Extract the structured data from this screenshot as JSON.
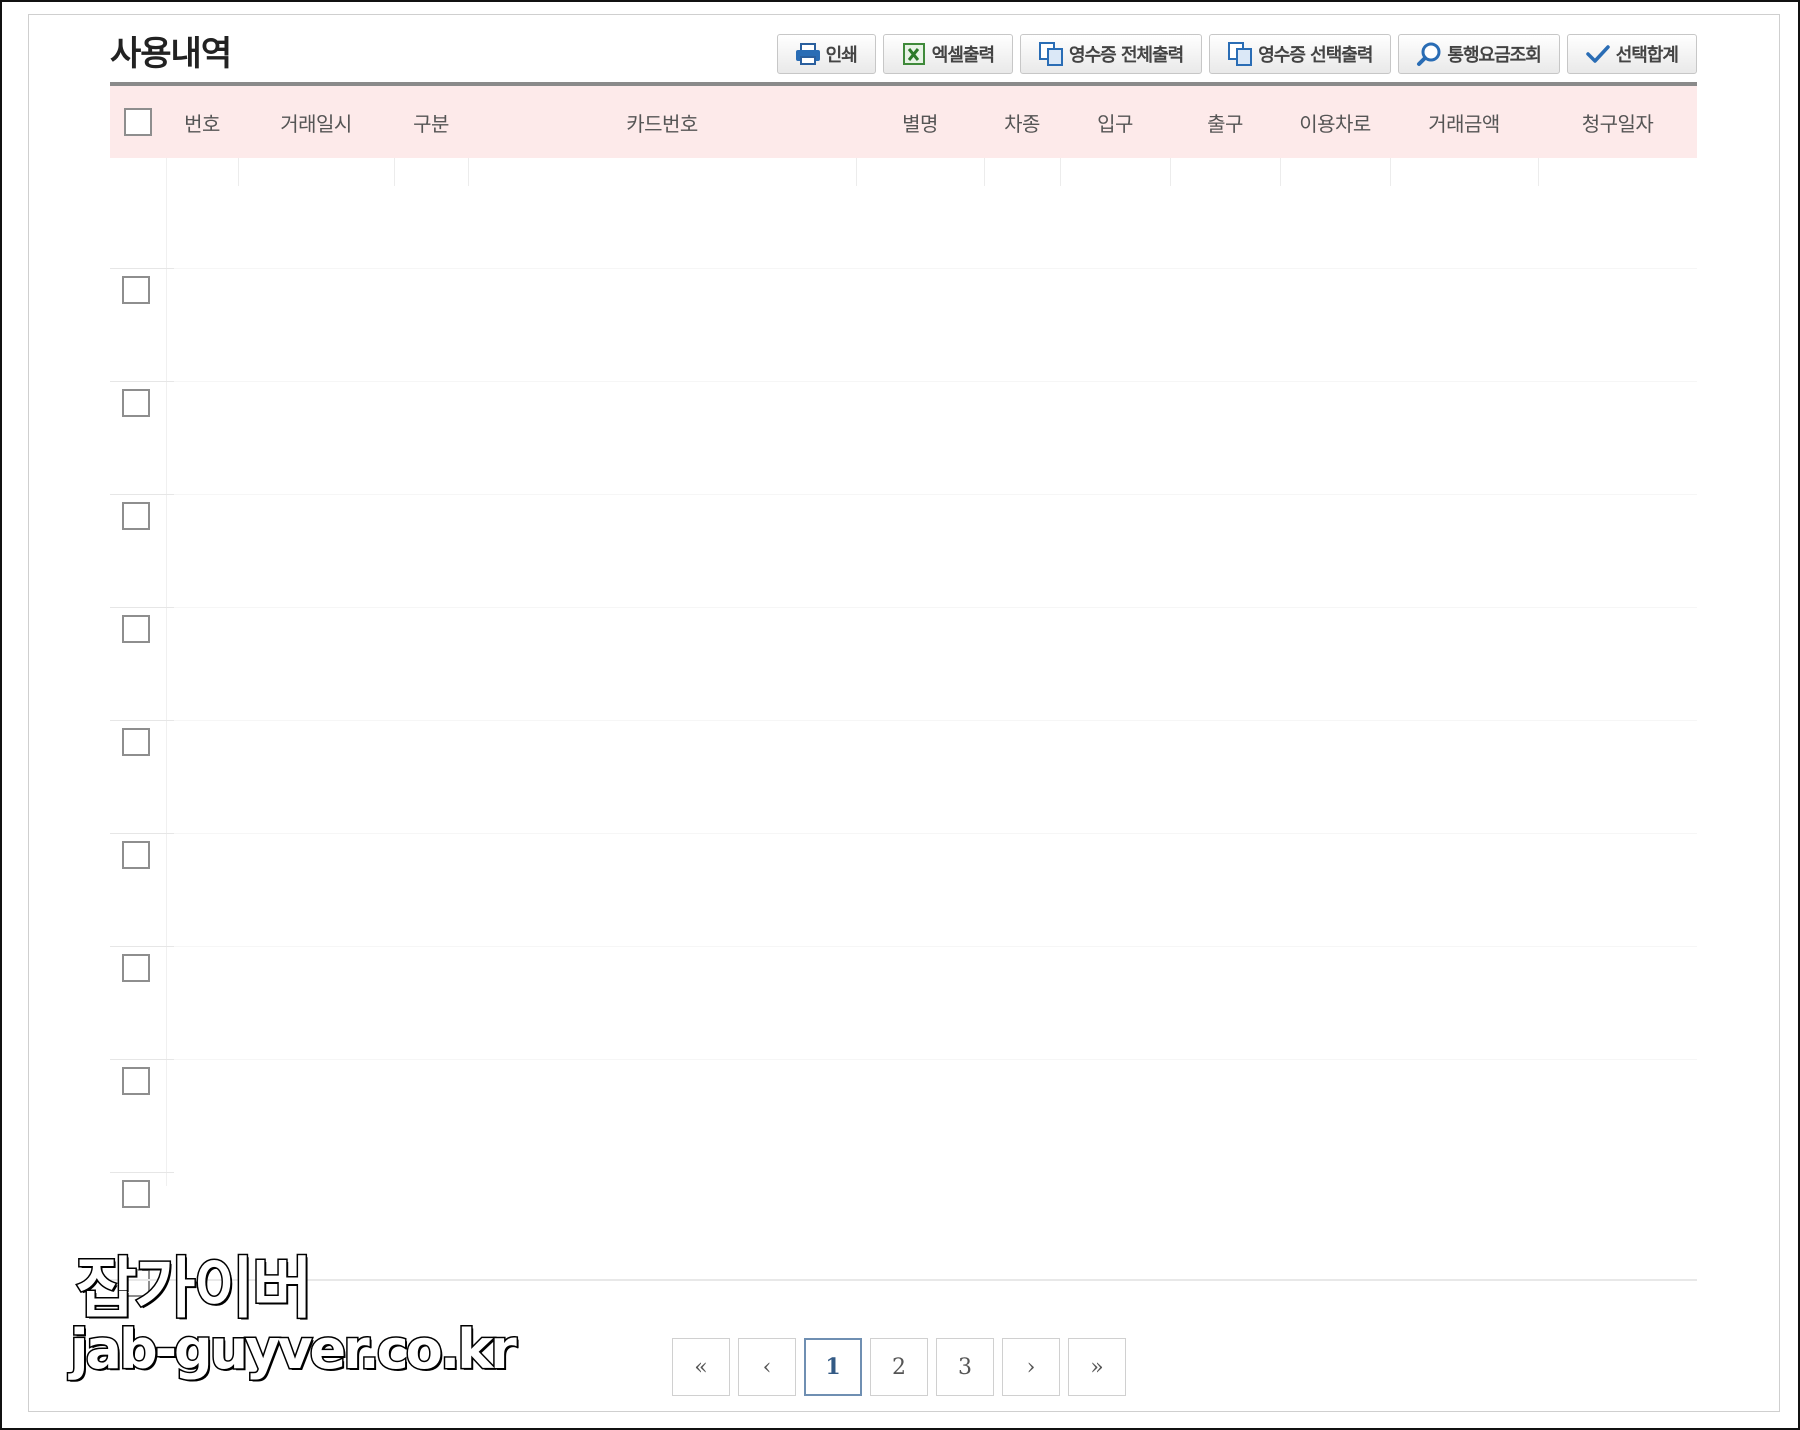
{
  "page": {
    "title": "사용내역"
  },
  "toolbar": {
    "buttons": [
      {
        "label": "인쇄",
        "icon": "printer-icon"
      },
      {
        "label": "엑셀출력",
        "icon": "excel-icon"
      },
      {
        "label": "영수증 전체출력",
        "icon": "copy-document-icon"
      },
      {
        "label": "영수증 선택출력",
        "icon": "copy-document-icon"
      },
      {
        "label": "통행요금조회",
        "icon": "search-icon"
      },
      {
        "label": "선택합계",
        "icon": "check-icon"
      }
    ]
  },
  "table": {
    "columns": [
      "번호",
      "거래일시",
      "구분",
      "카드번호",
      "별명",
      "차종",
      "입구",
      "출구",
      "이용차로",
      "거래금액",
      "청구일자"
    ],
    "header_bg": "#fdeaea"
  },
  "pagination": {
    "first": "«",
    "prev": "‹",
    "pages": [
      "1",
      "2",
      "3"
    ],
    "current": "1",
    "next": "›",
    "last": "»"
  },
  "watermark": {
    "name": "잡가이버",
    "url": "jab-guyver.co.kr"
  }
}
